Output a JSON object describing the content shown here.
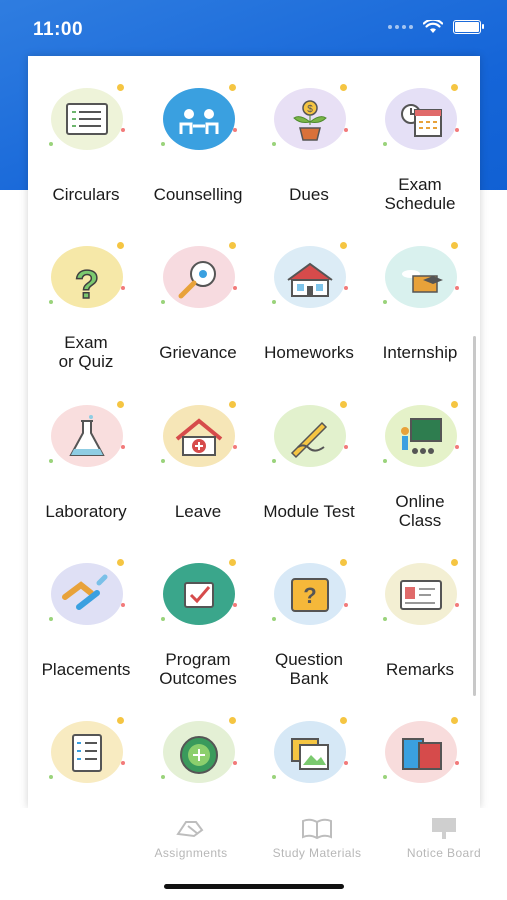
{
  "status": {
    "time": "11:00"
  },
  "menu": [
    {
      "label": "Circulars",
      "icon": "circulars-icon",
      "bg": "#eef3d9"
    },
    {
      "label": "Counselling",
      "icon": "counselling-icon",
      "bg": "#3aa0e0"
    },
    {
      "label": "Dues",
      "icon": "dues-icon",
      "bg": "#e8e0f5"
    },
    {
      "label": "Exam\nSchedule",
      "icon": "exam-schedule-icon",
      "bg": "#e5e0f6"
    },
    {
      "label": "Exam\nor Quiz",
      "icon": "question-icon",
      "bg": "#f6e8a8"
    },
    {
      "label": "Grievance",
      "icon": "grievance-icon",
      "bg": "#f7dbe0"
    },
    {
      "label": "Homeworks",
      "icon": "homeworks-icon",
      "bg": "#dcecf6"
    },
    {
      "label": "Internship",
      "icon": "internship-icon",
      "bg": "#d9f1ee"
    },
    {
      "label": "Laboratory",
      "icon": "laboratory-icon",
      "bg": "#f9dede"
    },
    {
      "label": "Leave",
      "icon": "leave-icon",
      "bg": "#f6e6b7"
    },
    {
      "label": "Module Test",
      "icon": "module-test-icon",
      "bg": "#e2f1cd"
    },
    {
      "label": "Online\nClass",
      "icon": "online-class-icon",
      "bg": "#e5f2c9"
    },
    {
      "label": "Placements",
      "icon": "placements-icon",
      "bg": "#dfe0f5"
    },
    {
      "label": "Program\nOutcomes",
      "icon": "program-outcomes-icon",
      "bg": "#3aa68b"
    },
    {
      "label": "Question\nBank",
      "icon": "question-bank-icon",
      "bg": "#d8e9f7"
    },
    {
      "label": "Remarks",
      "icon": "remarks-icon",
      "bg": "#f3efd3"
    },
    {
      "label": "",
      "icon": "checklist-icon",
      "bg": "#f8ebc1"
    },
    {
      "label": "",
      "icon": "add-circle-icon",
      "bg": "#e4f0d5"
    },
    {
      "label": "",
      "icon": "photos-icon",
      "bg": "#d6e8f6"
    },
    {
      "label": "",
      "icon": "books-icon",
      "bg": "#f8dcdc"
    }
  ],
  "tabs": [
    {
      "label": "Assignments",
      "icon": "assignments-icon"
    },
    {
      "label": "Study Materials",
      "icon": "study-materials-icon"
    },
    {
      "label": "Notice Board",
      "icon": "notice-board-icon"
    }
  ]
}
